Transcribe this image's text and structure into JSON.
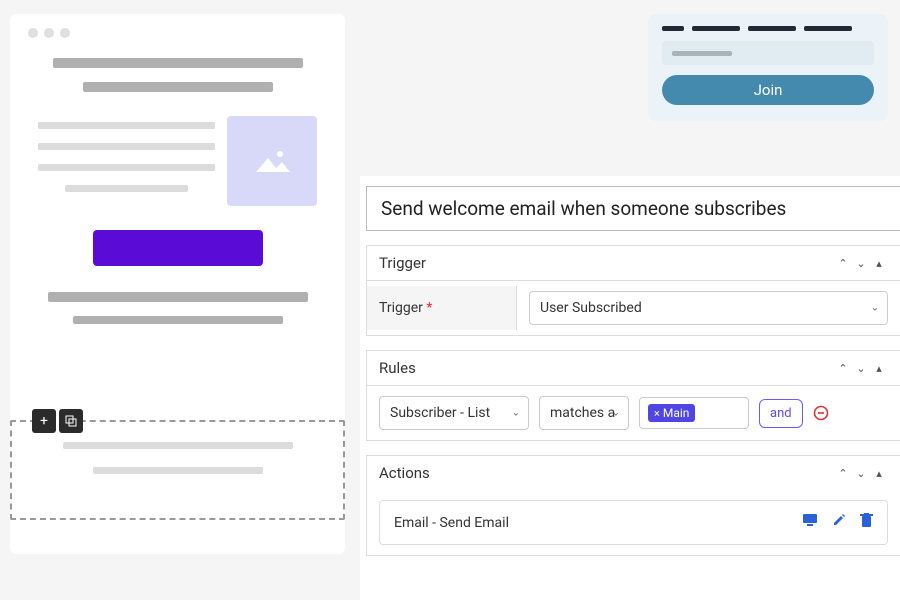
{
  "join": {
    "button": "Join"
  },
  "panel": {
    "title": "Send welcome email when someone subscribes",
    "trigger": {
      "heading": "Trigger",
      "label": "Trigger",
      "value": "User Subscribed"
    },
    "rules": {
      "heading": "Rules",
      "field": "Subscriber - List",
      "operator": "matches a",
      "tag": "Main",
      "conj": "and"
    },
    "actions": {
      "heading": "Actions",
      "item": "Email - Send Email"
    }
  }
}
